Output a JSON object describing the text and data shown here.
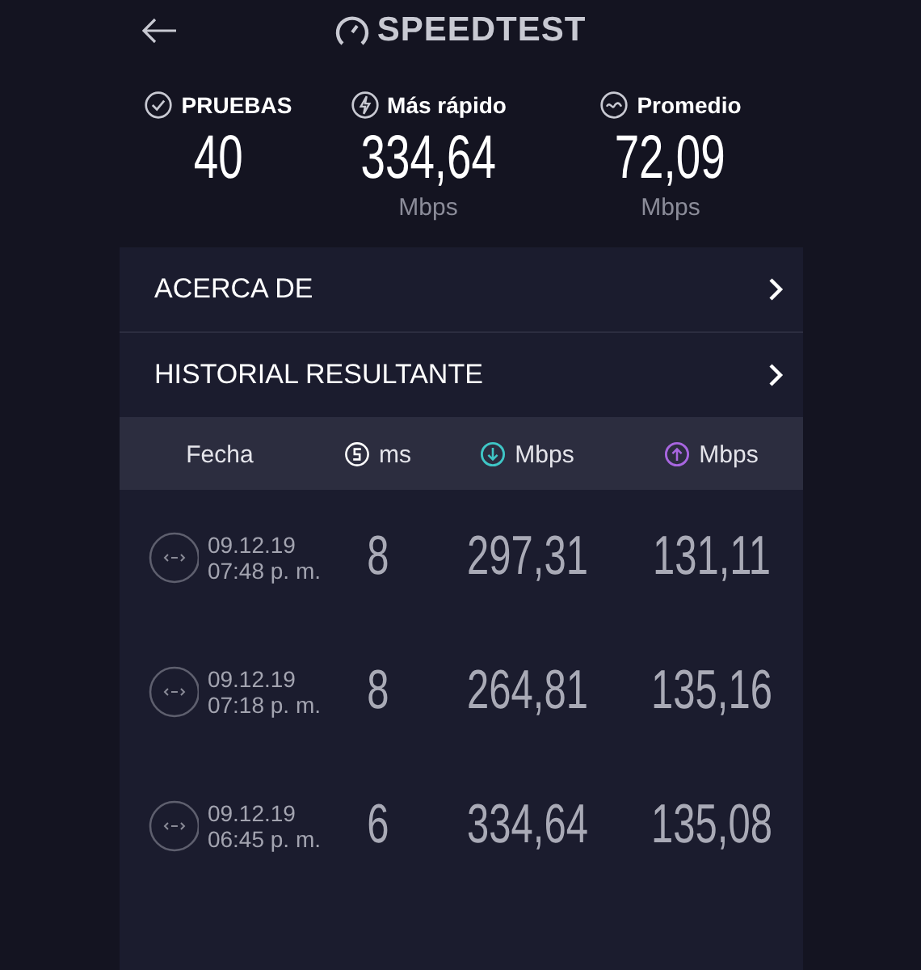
{
  "header": {
    "logo": "SPEEDTEST"
  },
  "stats": [
    {
      "kind": "tests",
      "label": "PRUEBAS",
      "value": "40"
    },
    {
      "kind": "fastest",
      "label": "Más rápido",
      "value": "334,64",
      "unit": "Mbps"
    },
    {
      "kind": "average",
      "label": "Promedio",
      "value": "72,09",
      "unit": "Mbps"
    }
  ],
  "menu": [
    {
      "label": "ACERCA DE"
    },
    {
      "label": "HISTORIAL RESULTANTE"
    }
  ],
  "table": {
    "columns": [
      {
        "kind": "date",
        "label": "Fecha"
      },
      {
        "kind": "ping",
        "label": "ms"
      },
      {
        "kind": "download",
        "label": "Mbps"
      },
      {
        "kind": "upload",
        "label": "Mbps"
      }
    ],
    "rows": [
      {
        "date": "09.12.19",
        "time": "07:48 p. m.",
        "ping": "8",
        "download": "297,31",
        "upload": "131,11"
      },
      {
        "date": "09.12.19",
        "time": "07:18 p. m.",
        "ping": "8",
        "download": "264,81",
        "upload": "135,16"
      },
      {
        "date": "09.12.19",
        "time": "06:45 p. m.",
        "ping": "6",
        "download": "334,64",
        "upload": "135,08"
      }
    ]
  }
}
